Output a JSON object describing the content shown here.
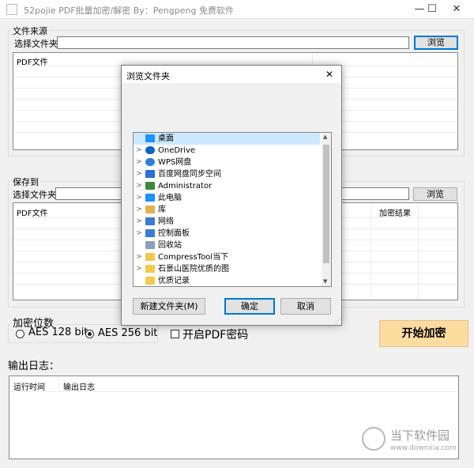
{
  "window": {
    "title": "52pojie  PDF批量加密/解密  By：Pengpeng  免费软件",
    "minimize": "—",
    "maximize": "☐",
    "close": "✕"
  },
  "source": {
    "group_label": "文件来源",
    "select_label": "选择文件夹",
    "folder_value": "",
    "browse_label": "浏览",
    "list_header": "PDF文件"
  },
  "save": {
    "group_label": "保存到",
    "select_label": "选择文件夹",
    "folder_value": "",
    "browse_label": "浏览",
    "col_file": "PDF文件",
    "col_result": "加密结果"
  },
  "encryption": {
    "group_label": "加密位数",
    "option_128": "AES 128 bit",
    "option_256": "AES 256 bit",
    "selected": "AES 256 bit",
    "pdf_password_label": "开启PDF密码",
    "start_label": "开始加密"
  },
  "log": {
    "title": "输出日志：",
    "col_time": "运行时间",
    "col_log": "输出日志"
  },
  "dialog": {
    "title": "浏览文件夹",
    "close": "✕",
    "new_folder_label": "新建文件夹(M)",
    "ok_label": "确定",
    "cancel_label": "取消",
    "tree": [
      {
        "label": "桌面",
        "icon": "desktop-icon",
        "chev": "",
        "color": "#1e90ff"
      },
      {
        "label": "OneDrive",
        "icon": "cloud-icon",
        "chev": ">",
        "color": "#0a64c8"
      },
      {
        "label": "WPS网盘",
        "icon": "cloud-icon",
        "chev": ">",
        "color": "#2e7fd9"
      },
      {
        "label": "百度网盘同步空间",
        "icon": "baidu-icon",
        "chev": ">",
        "color": "#2a6fd6"
      },
      {
        "label": "Administrator",
        "icon": "user-icon",
        "chev": ">",
        "color": "#3b8a3b"
      },
      {
        "label": "此电脑",
        "icon": "computer-icon",
        "chev": ">",
        "color": "#1e90ff"
      },
      {
        "label": "库",
        "icon": "library-icon",
        "chev": ">",
        "color": "#e0b24c"
      },
      {
        "label": "网络",
        "icon": "network-icon",
        "chev": ">",
        "color": "#3a7bd5"
      },
      {
        "label": "控制面板",
        "icon": "control-panel-icon",
        "chev": ">",
        "color": "#3a7bd5"
      },
      {
        "label": "回收站",
        "icon": "recycle-bin-icon",
        "chev": "",
        "color": "#8aa0b8"
      },
      {
        "label": "CompressTool当下",
        "icon": "folder-icon",
        "chev": ">",
        "color": "#f2c94c"
      },
      {
        "label": "石景山医院优质的图",
        "icon": "folder-icon",
        "chev": ">",
        "color": "#f2c94c"
      },
      {
        "label": "优质记录",
        "icon": "folder-icon",
        "chev": "",
        "color": "#f2c94c"
      }
    ]
  },
  "watermark": {
    "text": "当下软件园",
    "url_text": "www.downxia.com"
  }
}
